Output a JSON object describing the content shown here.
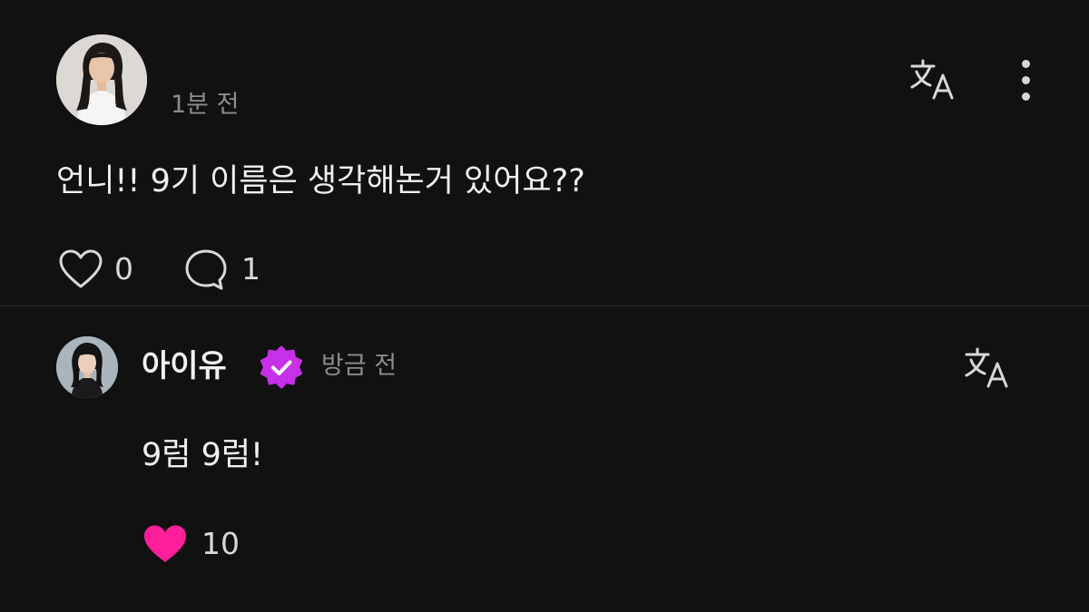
{
  "post": {
    "time": "1분 전",
    "text": "언니!! 9기 이름은 생각해논거 있어요??",
    "like_count": "0",
    "reply_count": "1",
    "avatar_icon": "user-photo-avatar",
    "icons": [
      "translate-icon",
      "more-vertical-icon",
      "heart-outline-icon",
      "comment-icon"
    ]
  },
  "reply": {
    "author": "아이유",
    "time": "방금 전",
    "text": "9럼 9럼!",
    "like_count": "10",
    "avatar_icon": "artist-photo-avatar",
    "icons": [
      "verified-badge-icon",
      "translate-icon",
      "heart-filled-icon"
    ]
  },
  "colors": {
    "background": "#111112",
    "text": "#f0f0f0",
    "muted": "#8c8c8c",
    "verified": "#c630e6",
    "liked_heart": "#ff1f9a"
  }
}
